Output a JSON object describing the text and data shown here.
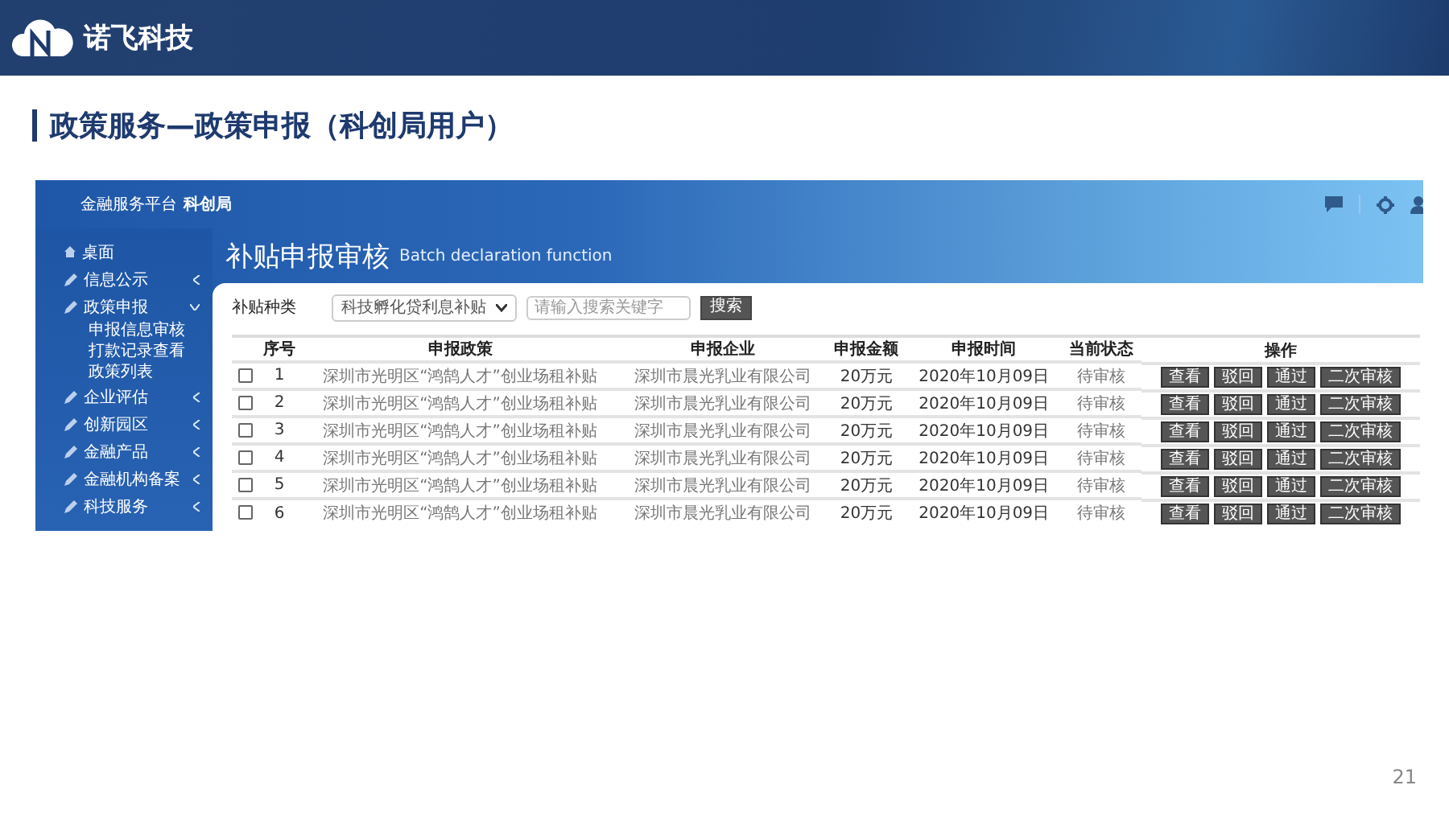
{
  "brand": {
    "name": "诺飞科技"
  },
  "slide_title": "政策服务—政策申报（科创局用户）",
  "app": {
    "platform_title": "金融服务平台",
    "platform_org": "科创局",
    "sidebar": {
      "items": [
        {
          "label": "桌面",
          "kind": "home"
        },
        {
          "label": "信息公示",
          "kind": "group",
          "expanded": false
        },
        {
          "label": "政策申报",
          "kind": "group",
          "expanded": true,
          "children": [
            {
              "label": "申报信息审核"
            },
            {
              "label": "打款记录查看"
            },
            {
              "label": "政策列表"
            }
          ]
        },
        {
          "label": "企业评估",
          "kind": "group",
          "expanded": false
        },
        {
          "label": "创新园区",
          "kind": "group",
          "expanded": false
        },
        {
          "label": "金融产品",
          "kind": "group",
          "expanded": false
        },
        {
          "label": "金融机构备案",
          "kind": "group",
          "expanded": false
        },
        {
          "label": "科技服务",
          "kind": "group",
          "expanded": false
        }
      ]
    },
    "page_title": "补贴申报审核",
    "page_subtitle": "Batch declaration function",
    "filter": {
      "label": "补贴种类",
      "select_value": "科技孵化贷利息补贴",
      "search_placeholder": "请输入搜索关键字",
      "search_button": "搜索"
    },
    "table": {
      "columns": [
        "序号",
        "申报政策",
        "申报企业",
        "申报金额",
        "申报时间",
        "当前状态",
        "操作"
      ],
      "rows": [
        {
          "checked": false,
          "cells": [
            "1",
            "深圳市光明区“鸿鹄人才”创业场租补贴",
            "深圳市晨光乳业有限公司",
            "20万元",
            "2020年10月09日",
            "待审核"
          ],
          "actions": [
            "查看",
            "驳回",
            "通过",
            "二次审核"
          ]
        },
        {
          "checked": false,
          "cells": [
            "2",
            "深圳市光明区“鸿鹄人才”创业场租补贴",
            "深圳市晨光乳业有限公司",
            "20万元",
            "2020年10月09日",
            "待审核"
          ],
          "actions": [
            "查看",
            "驳回",
            "通过",
            "二次审核"
          ]
        },
        {
          "checked": false,
          "cells": [
            "3",
            "深圳市光明区“鸿鹄人才”创业场租补贴",
            "深圳市晨光乳业有限公司",
            "20万元",
            "2020年10月09日",
            "待审核"
          ],
          "actions": [
            "查看",
            "驳回",
            "通过",
            "二次审核"
          ]
        },
        {
          "checked": false,
          "cells": [
            "4",
            "深圳市光明区“鸿鹄人才”创业场租补贴",
            "深圳市晨光乳业有限公司",
            "20万元",
            "2020年10月09日",
            "待审核"
          ],
          "actions": [
            "查看",
            "驳回",
            "通过",
            "二次审核"
          ]
        },
        {
          "checked": false,
          "cells": [
            "5",
            "深圳市光明区“鸿鹄人才”创业场租补贴",
            "深圳市晨光乳业有限公司",
            "20万元",
            "2020年10月09日",
            "待审核"
          ],
          "actions": [
            "查看",
            "驳回",
            "通过",
            "二次审核"
          ]
        },
        {
          "checked": false,
          "cells": [
            "6",
            "深圳市光明区“鸿鹄人才”创业场租补贴",
            "深圳市晨光乳业有限公司",
            "20万元",
            "2020年10月09日",
            "待审核"
          ],
          "actions": [
            "查看",
            "驳回",
            "通过",
            "二次审核"
          ]
        }
      ]
    }
  },
  "page_number": "21"
}
